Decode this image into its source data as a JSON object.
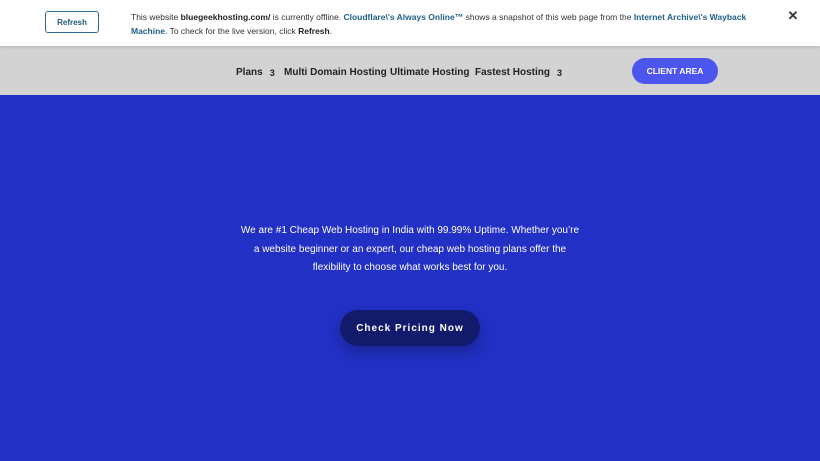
{
  "banner": {
    "refresh_label": "Refresh",
    "msg_prefix": "This website ",
    "site": "bluegeekhosting.com/",
    "msg_mid1": " is currently offline. ",
    "cloudflare_link": "Cloudflare\\'s Always Online™",
    "msg_mid2": " shows a snapshot of this web page from the ",
    "archive_link": "Internet Archive\\'s Wayback Machine",
    "msg_mid3": ". To check for the live version, click ",
    "refresh_word": "Refresh",
    "msg_end": ".",
    "close_icon": "✕"
  },
  "nav": {
    "items": [
      {
        "label": "Plans",
        "arrow": "3"
      },
      {
        "label": "Multi Domain Hosting"
      },
      {
        "label": "Ultimate Hosting"
      },
      {
        "label": "Fastest Hosting",
        "arrow": "3"
      }
    ],
    "client_area": "CLIENT AREA"
  },
  "hero": {
    "text": "We are #1 Cheap Web Hosting in India with 99.99% Uptime. Whether you’re a website beginner or an expert, our cheap web hosting plans offer the flexibility to choose what works best for you.",
    "cta": "Check Pricing Now"
  },
  "colors": {
    "hero_bg": "#2230c5",
    "nav_bg": "#d3d3d3",
    "client_btn": "#4c55ee",
    "cta_btn": "#111a6b"
  }
}
